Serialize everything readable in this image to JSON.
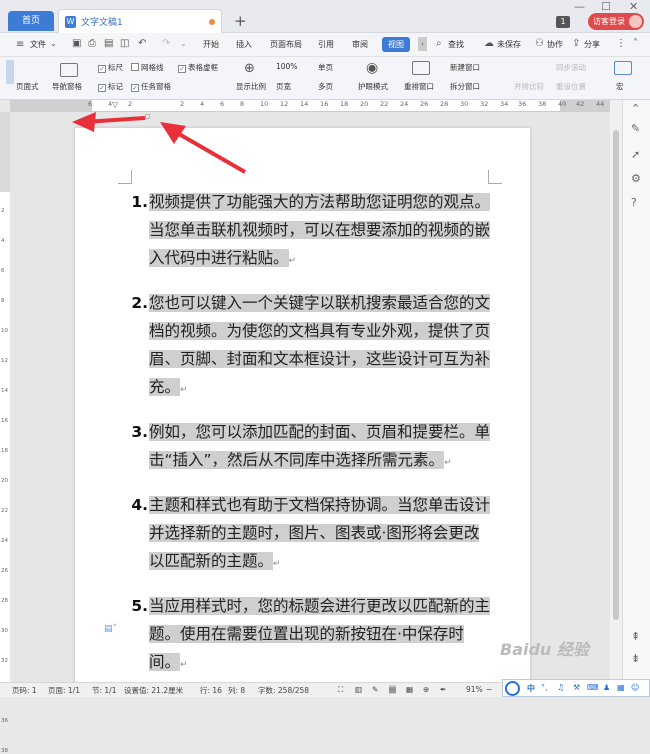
{
  "titlebar": {
    "home_tab": "首页",
    "doc_tab": "文字文稿1",
    "new_tab": "+",
    "badge": "1",
    "login": "访客登录",
    "minimize": "—",
    "restore": "☐",
    "close": "✕"
  },
  "menubar": {
    "file": "文件",
    "items": [
      "开始",
      "插入",
      "页面布局",
      "引用",
      "审阅",
      "视图"
    ],
    "active": "视图",
    "search": "查找",
    "unsaved": "未保存",
    "collab": "协作",
    "share": "分享"
  },
  "toolbar": {
    "page_mode": "页面式",
    "nav_pane": "导航窗格",
    "ruler": "标尺",
    "gridlines": "网格线",
    "table_border": "表格虚框",
    "mark": "标记",
    "task_pane": "任务窗格",
    "zoom": "显示比例",
    "zoom_100": "100%",
    "page_width": "页宽",
    "single_page": "单页",
    "multi_page": "多页",
    "eye_mode": "护眼模式",
    "rearrange": "重排窗口",
    "new_window": "新建窗口",
    "split_window": "拆分窗口",
    "side_by_side": "并排比较",
    "sync_scroll": "同步滚动",
    "reset_position": "重设位置",
    "macro": "宏"
  },
  "ruler": {
    "numbers": [
      "6",
      "4",
      "2",
      "2",
      "4",
      "6",
      "8",
      "10",
      "12",
      "14",
      "16",
      "18",
      "20",
      "22",
      "24",
      "26",
      "28",
      "30",
      "32",
      "34",
      "36",
      "38",
      "40",
      "42",
      "44",
      "46"
    ],
    "vnumbers": [
      "2",
      "4",
      "6",
      "8",
      "10",
      "12",
      "14",
      "16",
      "18",
      "20",
      "22",
      "24",
      "26",
      "28",
      "30",
      "32",
      "34",
      "36",
      "38"
    ]
  },
  "document": {
    "items": [
      {
        "num": "1.",
        "text": "视频提供了功能强大的方法帮助您证明您的观点。当您单击联机视频时，可以在想要添加的视频的嵌入代码中进行粘贴。"
      },
      {
        "num": "2.",
        "text": "您也可以键入一个关键字以联机搜索最适合您的文档的视频。为使您的文档具有专业外观，提供了页眉、页脚、封面和文本框设计，这些设计可互为补充。"
      },
      {
        "num": "3.",
        "text": "例如，您可以添加匹配的封面、页眉和提要栏。单击“插入”，然后从不同库中选择所需元素。"
      },
      {
        "num": "4.",
        "text": "主题和样式也有助于文档保持协调。当您单击设计并选择新的主题时，图片、图表或·图形将会更改以匹配新的主题。"
      },
      {
        "num": "5.",
        "text": "当应用样式时，您的标题会进行更改以匹配新的主题。使用在需要位置出现的新按钮在·中保存时间。"
      }
    ],
    "para_mark": "↵"
  },
  "status": {
    "page_num": "页码: 1",
    "pages": "页面: 1/1",
    "section": "节: 1/1",
    "settings": "设置值: 21.2厘米",
    "row": "行: 16",
    "col": "列: 8",
    "words": "字数: 258/258",
    "zoom": "91%"
  },
  "ime": {
    "mode": "中",
    "punct": "°,"
  },
  "watermark": "Baidu 经验",
  "colors": {
    "accent": "#3c7bd6",
    "login": "#e04a4a",
    "selection": "#cfcfcf",
    "arrow": "#e8303a"
  }
}
